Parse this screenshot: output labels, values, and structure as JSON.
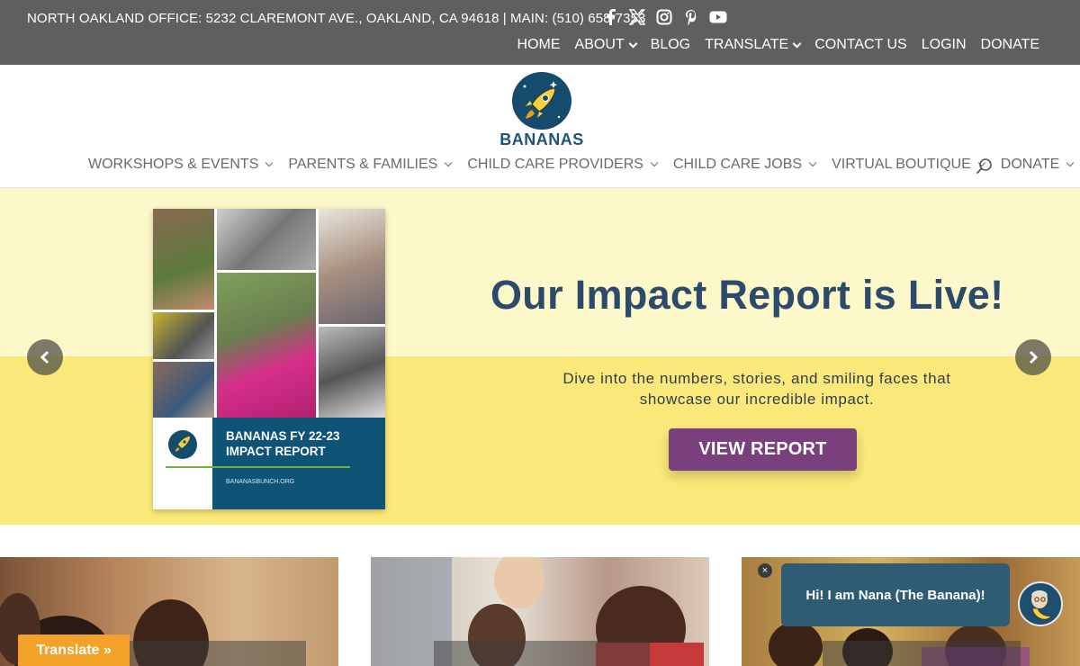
{
  "topbar": {
    "address": "NORTH OAKLAND OFFICE: 5232 CLAREMONT AVE., OAKLAND, CA 94618 | MAIN: (510) 658-7353",
    "social": [
      "facebook-icon",
      "x-icon",
      "instagram-icon",
      "pinterest-icon",
      "youtube-icon"
    ],
    "nav": [
      {
        "label": "HOME",
        "dropdown": false
      },
      {
        "label": "ABOUT",
        "dropdown": true
      },
      {
        "label": "BLOG",
        "dropdown": false
      },
      {
        "label": "TRANSLATE",
        "dropdown": true
      },
      {
        "label": "CONTACT US",
        "dropdown": false
      },
      {
        "label": "LOGIN",
        "dropdown": false
      },
      {
        "label": "DONATE",
        "dropdown": false
      }
    ]
  },
  "header": {
    "logo_text": "BANANAS",
    "nav": [
      {
        "label": "WORKSHOPS & EVENTS"
      },
      {
        "label": "PARENTS & FAMILIES"
      },
      {
        "label": "CHILD CARE PROVIDERS"
      },
      {
        "label": "CHILD CARE JOBS"
      },
      {
        "label": "VIRTUAL BOUTIQUE"
      },
      {
        "label": "DONATE"
      }
    ]
  },
  "hero": {
    "title": "Our Impact Report is Live!",
    "subtitle": "Dive into the numbers, stories, and smiling faces that showcase our incredible impact.",
    "cta": "VIEW REPORT",
    "report_title": "BANANAS FY 22-23 IMPACT REPORT",
    "report_url": "BANANASBUNCH.ORG"
  },
  "widgets": {
    "translate": "Translate »",
    "chat_message": "Hi! I am Nana (The Banana)!",
    "chat_close": "×"
  },
  "colors": {
    "topbar": "#5f5f5f",
    "hero_yellow": "#fae97a",
    "hero_light": "#fdf8c9",
    "title": "#2c4a6b",
    "cta": "#7a3f7d",
    "translate": "#f3a128",
    "chat": "#2f5c73"
  }
}
